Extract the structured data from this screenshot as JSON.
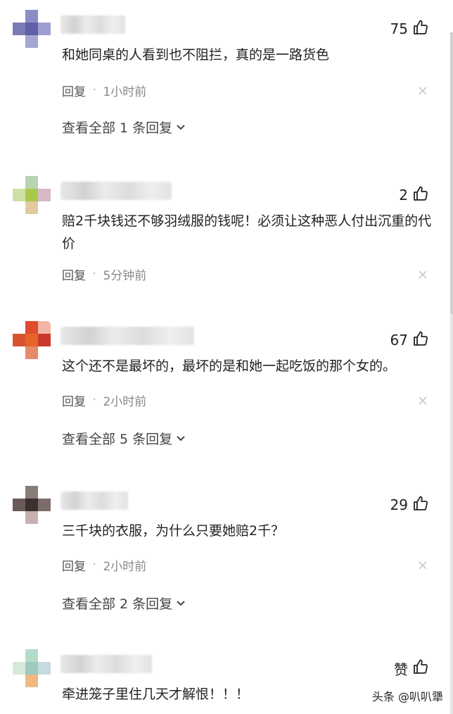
{
  "comments": [
    {
      "likes": "75",
      "text": "和她同桌的人看到也不阻拦，真的是一路货色",
      "reply_label": "回复",
      "time": "1小时前",
      "view_all": "查看全部 1 条回复",
      "avatar_colors": [
        "#ffffff",
        "#8d8dc6",
        "#ffffff",
        "#7a7ab5",
        "#5f60a8",
        "#9e9ed0",
        "#ffffff",
        "#a6a6d4",
        "#ffffff"
      ]
    },
    {
      "likes": "2",
      "text": "赔2千块钱还不够羽绒服的钱呢！必须让这种恶人付出沉重的代价",
      "reply_label": "回复",
      "time": "5分钟前",
      "avatar_colors": [
        "#ffffff",
        "#b8d4b0",
        "#ffffff",
        "#cde0a8",
        "#a9c94a",
        "#d7b9c9",
        "#ffffff",
        "#e3c9a0",
        "#ffffff"
      ]
    },
    {
      "likes": "67",
      "text": "这个还不是最坏的，最坏的是和她一起吃饭的那个女的。",
      "reply_label": "回复",
      "time": "2小时前",
      "view_all": "查看全部 5 条回复",
      "avatar_colors": [
        "#ffffff",
        "#e04c2e",
        "#f3b5a5",
        "#d8542e",
        "#e6642a",
        "#c93a2a",
        "#ffffff",
        "#e78a6a",
        "#ffffff"
      ]
    },
    {
      "likes": "29",
      "text": "三千块的衣服，为什么只要她赔2千？",
      "reply_label": "回复",
      "time": "2小时前",
      "view_all": "查看全部 2 条回复",
      "avatar_colors": [
        "#ffffff",
        "#8a7a7a",
        "#ffffff",
        "#6a5a55",
        "#3a3030",
        "#7d6d68",
        "#ffffff",
        "#c8b0b0",
        "#ffffff"
      ]
    },
    {
      "likes": "赞",
      "text": "牵进笼子里住几天才解恨！！！",
      "avatar_colors": [
        "#ffffff",
        "#b5dbc8",
        "#ffffff",
        "#d7e8d9",
        "#9fc8c0",
        "#c6dbe0",
        "#ffffff",
        "#f0b884",
        "#ffffff"
      ]
    }
  ],
  "watermark": "头条 @叭叭犟",
  "icons": {
    "like": "thumbs-up-icon",
    "close": "close-icon",
    "expand": "chevron-down-icon"
  }
}
